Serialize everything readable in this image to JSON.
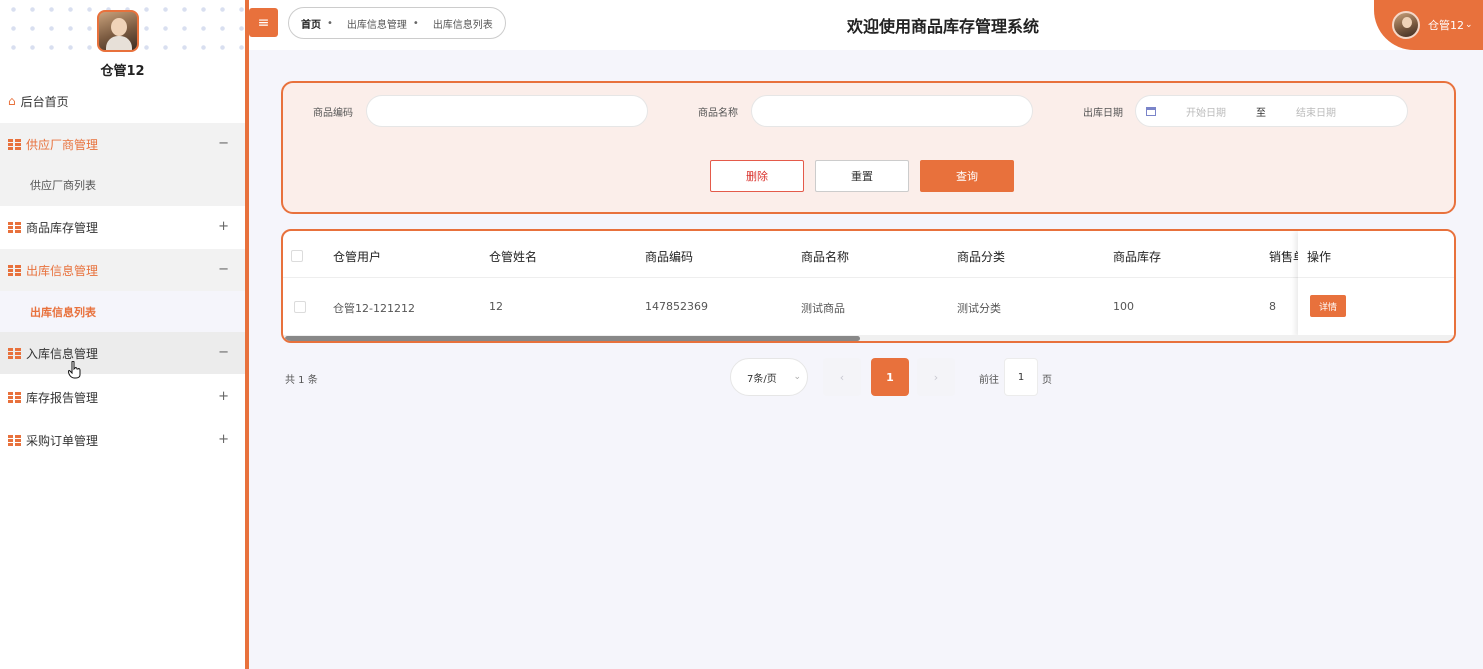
{
  "sidebar": {
    "username": "仓管12",
    "home": "后台首页",
    "groups": [
      {
        "label": "供应厂商管理",
        "toggle": "−",
        "children": [
          "供应厂商列表"
        ]
      },
      {
        "label": "商品库存管理",
        "toggle": "+"
      },
      {
        "label": "出库信息管理",
        "toggle": "−",
        "children": [
          "出库信息列表"
        ]
      },
      {
        "label": "入库信息管理",
        "toggle": "−"
      },
      {
        "label": "库存报告管理",
        "toggle": "+"
      },
      {
        "label": "采购订单管理",
        "toggle": "+"
      }
    ]
  },
  "header": {
    "menu_glyph": "≡",
    "breadcrumb": [
      "首页",
      "出库信息管理",
      "出库信息列表"
    ],
    "title": "欢迎使用商品库存管理系统",
    "user": "仓管12",
    "user_caret": "⌄"
  },
  "search": {
    "code_label": "商品编码",
    "name_label": "商品名称",
    "date_label": "出库日期",
    "date_start_placeholder": "开始日期",
    "date_sep": "至",
    "date_end_placeholder": "结束日期",
    "delete_label": "删除",
    "reset_label": "重置",
    "query_label": "查询"
  },
  "table": {
    "headers": [
      "仓管用户",
      "仓管姓名",
      "商品编码",
      "商品名称",
      "商品分类",
      "商品库存",
      "销售单价",
      "操作"
    ],
    "rows": [
      {
        "user": "仓管12-121212",
        "name": "12",
        "code": "147852369",
        "product": "测试商品",
        "category": "测试分类",
        "stock": "100",
        "price": "8",
        "action": "详情"
      }
    ]
  },
  "pagination": {
    "total": "共 1 条",
    "page_size": "7条/页",
    "current": "1",
    "prev": "‹",
    "next": "›",
    "goto_prefix": "前往",
    "goto_value": "1",
    "goto_suffix": "页"
  },
  "colors": {
    "accent": "#e8713c",
    "danger": "#d9302a"
  }
}
